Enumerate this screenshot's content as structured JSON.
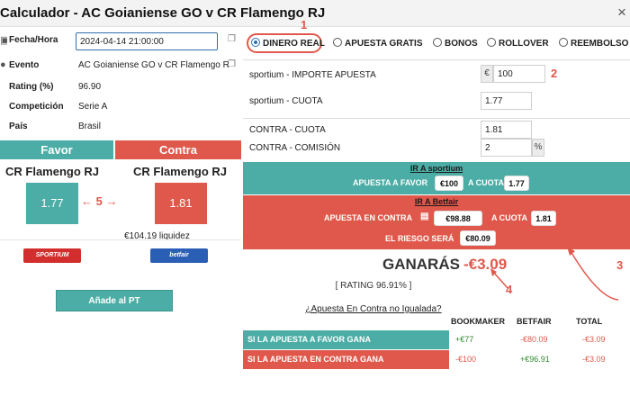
{
  "window": {
    "title": "Calculador - AC Goianiense GO v CR Flamengo RJ",
    "close_icon": "×"
  },
  "details": {
    "fecha_label": "Fecha/Hora",
    "fecha_value": "2024-04-14 21:00:00",
    "evento_label": "Evento",
    "evento_value": "AC Goianiense GO v CR Flamengo R",
    "rating_label": "Rating (%)",
    "rating_value": "96.90",
    "competicion_label": "Competición",
    "competicion_value": "Serie A",
    "pais_label": "País",
    "pais_value": "Brasil"
  },
  "favor": {
    "header": "Favor",
    "team": "CR Flamengo RJ",
    "odds": "1.77",
    "bookmaker": "SPORTIUM"
  },
  "contra": {
    "header": "Contra",
    "team": "CR Flamengo RJ",
    "odds": "1.81",
    "liquidity": "€104.19 liquidez",
    "bookmaker": "betfair"
  },
  "annotations": {
    "n1": "1",
    "n2": "2",
    "n3": "3",
    "n4": "4",
    "n5": "5",
    "arrow_left": "←",
    "arrow_right": "→"
  },
  "add_button": "Añade al PT",
  "modes": [
    {
      "label": "DINERO REAL",
      "selected": true
    },
    {
      "label": "APUESTA GRATIS",
      "selected": false
    },
    {
      "label": "BONOS",
      "selected": false
    },
    {
      "label": "ROLLOVER",
      "selected": false
    },
    {
      "label": "REEMBOLSO",
      "selected": false
    }
  ],
  "form": {
    "importe_label": "sportium - IMPORTE APUESTA",
    "currency_symbol": "€",
    "importe_value": "100",
    "cuota_label": "sportium - CUOTA",
    "cuota_value": "1.77",
    "contra_cuota_label": "CONTRA - CUOTA",
    "contra_cuota_value": "1.81",
    "comision_label": "CONTRA - COMISIÓN",
    "comision_value": "2",
    "percent_symbol": "%"
  },
  "sportium_block": {
    "title": "IR A sportium",
    "apuesta_label": "APUESTA A FAVOR",
    "apuesta_value": "€100",
    "cuota_label": "A CUOTA",
    "cuota_value": "1.77"
  },
  "betfair_block": {
    "title": "IR A Betfair",
    "apuesta_label": "APUESTA EN CONTRA",
    "apuesta_value": "€98.88",
    "cuota_label": "A CUOTA",
    "cuota_value": "1.81",
    "riesgo_label": "EL RIESGO SERÁ",
    "riesgo_value": "€80.09"
  },
  "result": {
    "ganaras_label": "GANARÁS",
    "ganaras_value": "-€3.09",
    "rating_text": "[ RATING 96.91% ]"
  },
  "table": {
    "link": "¿Apuesta En Contra no Igualada?",
    "headers": [
      "BOOKMAKER",
      "BETFAIR",
      "TOTAL"
    ],
    "rows": [
      {
        "label": "SI LA APUESTA A FAVOR GANA",
        "bookmaker": "+€77",
        "betfair": "-€80.09",
        "total": "-€3.09"
      },
      {
        "label": "SI LA APUESTA EN CONTRA GANA",
        "bookmaker": "-€100",
        "betfair": "+€96.91",
        "total": "-€3.09"
      }
    ]
  },
  "colors": {
    "teal": "#4bada5",
    "red": "#e0584b",
    "blue": "#2f6fb0",
    "green": "#2d8a2d"
  },
  "icons": {
    "calendar": "calendar-icon",
    "event": "event-icon",
    "copy": "copy-icon",
    "clipboard": "clipboard-icon"
  }
}
